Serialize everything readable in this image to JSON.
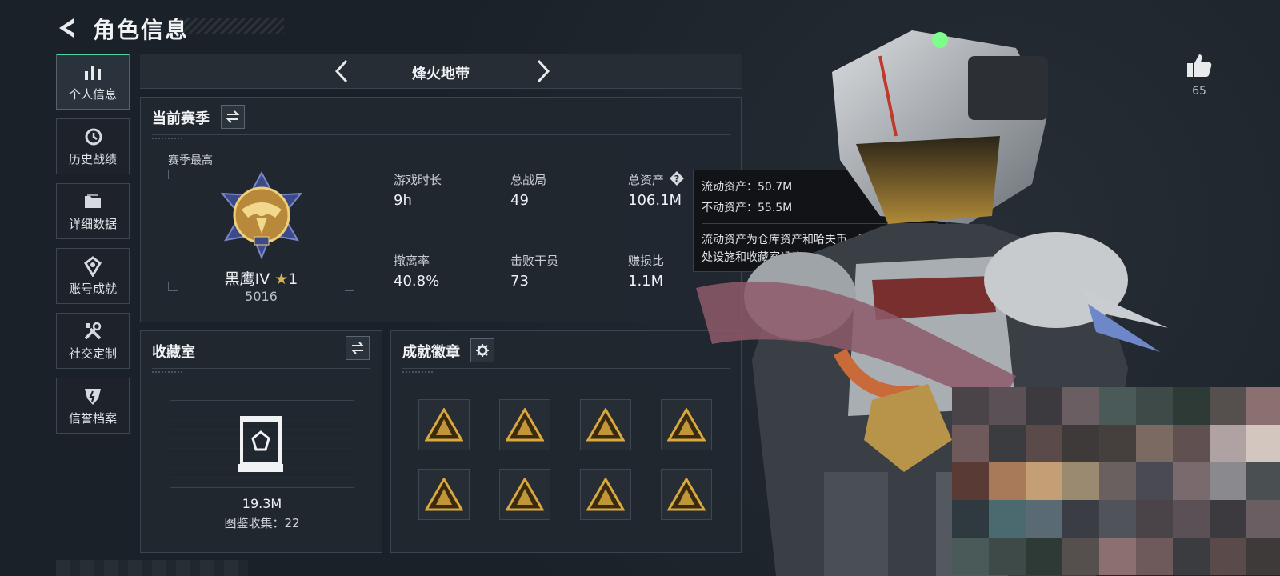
{
  "header": {
    "title": "角色信息"
  },
  "sidebar": {
    "items": [
      {
        "label": "个人信息",
        "icon": "bar-chart-icon",
        "active": true
      },
      {
        "label": "历史战绩",
        "icon": "history-clock-icon",
        "active": false
      },
      {
        "label": "详细数据",
        "icon": "folder-icon",
        "active": false
      },
      {
        "label": "账号成就",
        "icon": "achievement-icon",
        "active": false
      },
      {
        "label": "社交定制",
        "icon": "tools-icon",
        "active": false
      },
      {
        "label": "信誉档案",
        "icon": "reputation-icon",
        "active": false
      }
    ]
  },
  "mode": {
    "title": "烽火地带"
  },
  "season": {
    "title": "当前赛季",
    "best_label": "赛季最高",
    "rank_name": "黑鹰IV",
    "rank_star": "★",
    "rank_level": "1",
    "rank_score": "5016",
    "stats": [
      {
        "label": "游戏时长",
        "value": "9h"
      },
      {
        "label": "总战局",
        "value": "49"
      },
      {
        "label": "总资产",
        "value": "106.1M"
      },
      {
        "label": "撤离率",
        "value": "40.8%"
      },
      {
        "label": "击败干员",
        "value": "73"
      },
      {
        "label": "赚损比",
        "value": "1.1M"
      }
    ]
  },
  "tooltip": {
    "liquid": "流动资产：50.7M",
    "fixed": "不动资产：55.5M",
    "description": "流动资产为仓库资产和哈夫币，不动资产为特勤处设施和收藏室设施"
  },
  "collection": {
    "title": "收藏室",
    "value": "19.3M",
    "count": "图鉴收集：22"
  },
  "badges": {
    "title": "成就徽章",
    "items": [
      "badge-1",
      "badge-2",
      "badge-3",
      "badge-4",
      "badge-5",
      "badge-6",
      "badge-7",
      "badge-8"
    ]
  },
  "like": {
    "count": "65"
  },
  "colors": {
    "background": "#1b2129",
    "accent": "#4fd4a6",
    "gold": "#d9b25a",
    "panel": "#212830"
  }
}
